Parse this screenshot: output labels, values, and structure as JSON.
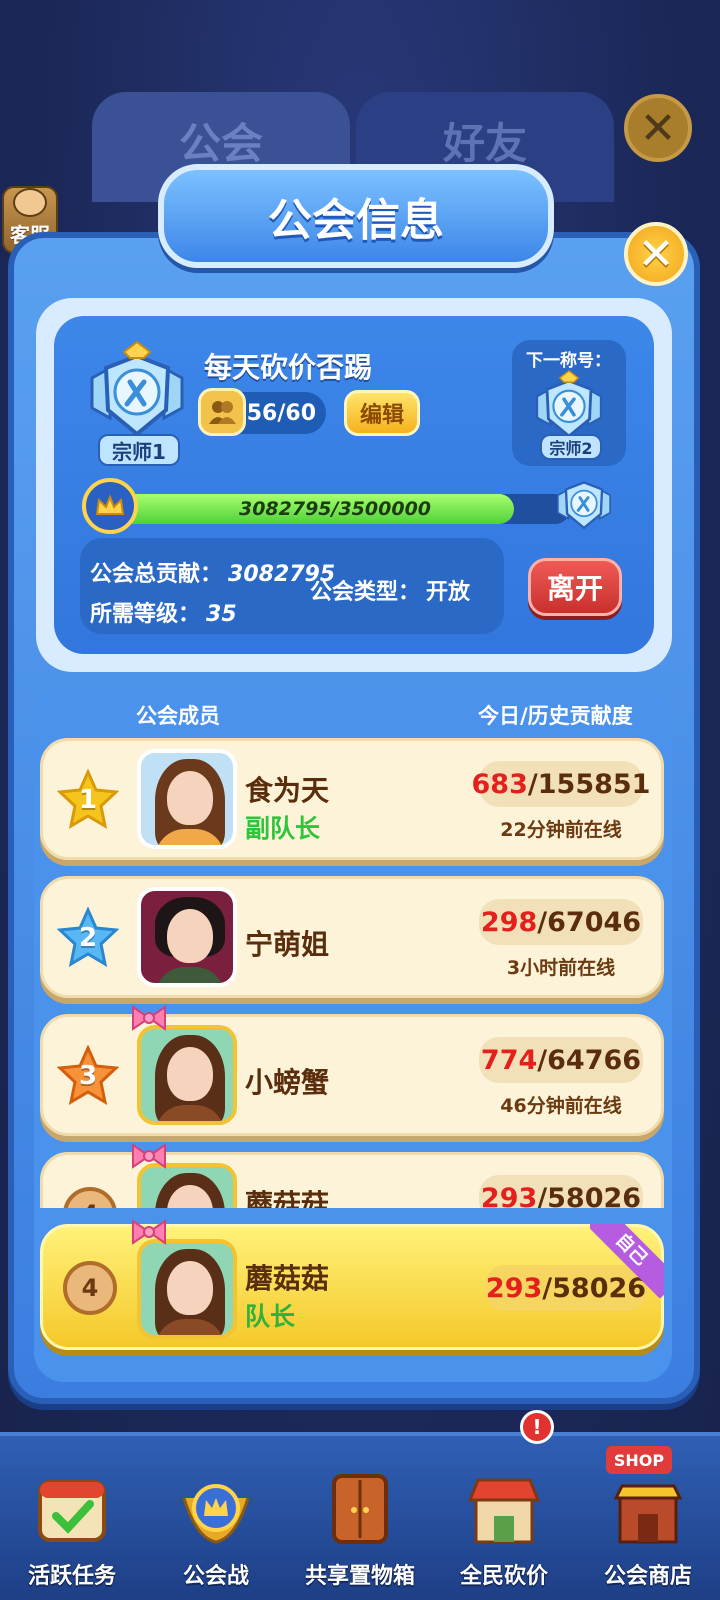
{
  "background": {
    "tabs": [
      "公会",
      "好友"
    ],
    "customer_service": "客服"
  },
  "dialog": {
    "title": "公会信息"
  },
  "guild": {
    "name": "每天砍价否踢",
    "members": "56/60",
    "edit_label": "编辑",
    "rank": "宗师1",
    "next_title_label": "下一称号：",
    "next_rank": "宗师2",
    "progress_text": "3082795/3500000",
    "progress_fraction": 0.8808,
    "total_contribution_label": "公会总贡献：",
    "total_contribution": "3082795",
    "required_level_label": "所需等级：",
    "required_level": "35",
    "type_label": "公会类型：",
    "type_value": "开放",
    "leave_label": "离开"
  },
  "members": {
    "header_left": "公会成员",
    "header_right": "今日/历史贡献度",
    "rows": [
      {
        "rank": "1",
        "name": "食为天",
        "role": "副队长",
        "today": "683",
        "total": "/155851",
        "online": "22分钟前在线",
        "star": "#f5c51e",
        "star_dark": "#d99a09"
      },
      {
        "rank": "2",
        "name": "宁萌姐",
        "role": "",
        "today": "298",
        "total": "/67046",
        "online": "3小时前在线",
        "star": "#57b8f5",
        "star_dark": "#2a86cf"
      },
      {
        "rank": "3",
        "name": "小螃蟹",
        "role": "",
        "today": "774",
        "total": "/64766",
        "online": "46分钟前在线",
        "star": "#f7923a",
        "star_dark": "#d35f0d"
      },
      {
        "rank": "4",
        "name": "蘑菇菇",
        "role": "",
        "today": "293",
        "total": "/58026",
        "online": "",
        "star": "#e9b87a",
        "star_dark": "#b06d2a"
      }
    ],
    "self": {
      "rank": "4",
      "name": "蘑菇菇",
      "role": "队长",
      "today": "293",
      "total": "/58026",
      "ribbon": "自己"
    }
  },
  "bottom_nav": [
    {
      "label": "活跃任务",
      "icon": "calendar-check-icon"
    },
    {
      "label": "公会战",
      "icon": "crown-shield-icon"
    },
    {
      "label": "共享置物箱",
      "icon": "cabinet-icon"
    },
    {
      "label": "全民砍价",
      "icon": "store-icon",
      "alert": "!"
    },
    {
      "label": "公会商店",
      "icon": "shop-icon",
      "tag": "SHOP"
    }
  ],
  "colors": {
    "deputy_role": "#2fc53a",
    "leader_role": "#2fb13a",
    "today_score": "#e5201c"
  }
}
